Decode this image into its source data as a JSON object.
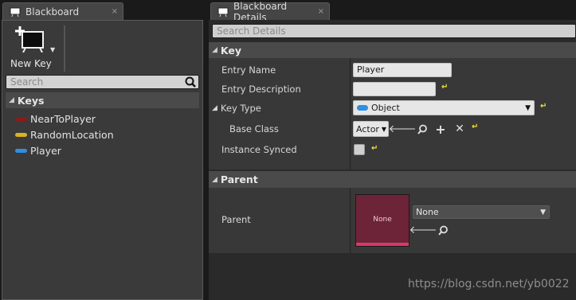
{
  "left_tab": {
    "title": "Blackboard",
    "close": "×"
  },
  "right_tab": {
    "title": "Blackboard Details",
    "close": "×"
  },
  "toolbar": {
    "new_key_label": "New Key"
  },
  "left_search": {
    "placeholder": "Search"
  },
  "keys_section": {
    "title": "Keys"
  },
  "keys": [
    {
      "name": "NearToPlayer",
      "color": "#8b1a1a"
    },
    {
      "name": "RandomLocation",
      "color": "#d8b322"
    },
    {
      "name": "Player",
      "color": "#2f8fe0"
    }
  ],
  "details_search": {
    "placeholder": "Search Details"
  },
  "key_section": {
    "title": "Key",
    "entry_name_label": "Entry Name",
    "entry_name_value": "Player",
    "entry_description_label": "Entry Description",
    "key_type_label": "Key Type",
    "key_type_value": "Object",
    "base_class_label": "Base Class",
    "base_class_value": "Actor",
    "instance_synced_label": "Instance Synced"
  },
  "parent_section": {
    "title": "Parent",
    "parent_label": "Parent",
    "thumbnail_text": "None",
    "parent_value": "None"
  },
  "watermark": "https://blog.csdn.net/yb0022",
  "colors": {
    "thumbnail": "#6e2438",
    "thumbnail_bar": "#d8386a",
    "object_pill": "#2f8fe0",
    "reset_arrow": "#f2e03b"
  }
}
